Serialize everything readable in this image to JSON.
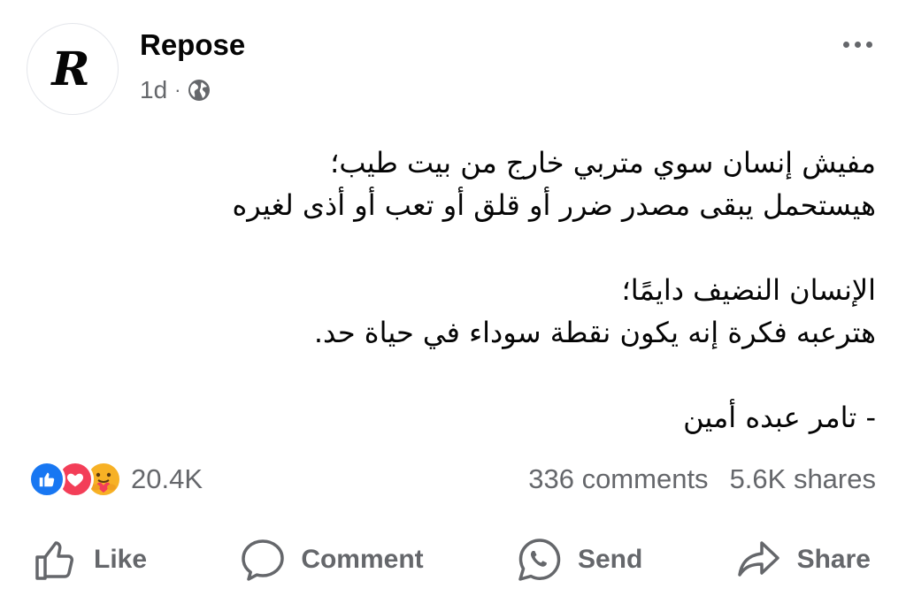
{
  "header": {
    "avatar_letter": "R",
    "page_name": "Repose",
    "timestamp": "1d",
    "separator": "·",
    "audience_icon": "globe-icon",
    "more_icon": "more-options-icon"
  },
  "post": {
    "lines": [
      "مفيش إنسان سوي متربي خارج من بيت طيب؛",
      "هيستحمل يبقى مصدر ضرر أو قلق أو تعب أو أذى لغيره",
      "",
      "الإنسان النضيف دايمًا؛",
      "هترعبه فكرة إنه يكون نقطة سوداء في حياة حد.",
      "",
      "- تامر عبده أمين"
    ]
  },
  "stats": {
    "reaction_icons": [
      "like-reaction-icon",
      "love-reaction-icon",
      "care-reaction-icon"
    ],
    "reactions": "20.4K",
    "comments": "336 comments",
    "shares": "5.6K shares"
  },
  "actions": {
    "like": "Like",
    "comment": "Comment",
    "send": "Send",
    "share": "Share"
  },
  "colors": {
    "secondary_text": "#65676b",
    "like_blue": "#1877f2",
    "love_red": "#f33e58",
    "care_yellow": "#f7b125"
  }
}
